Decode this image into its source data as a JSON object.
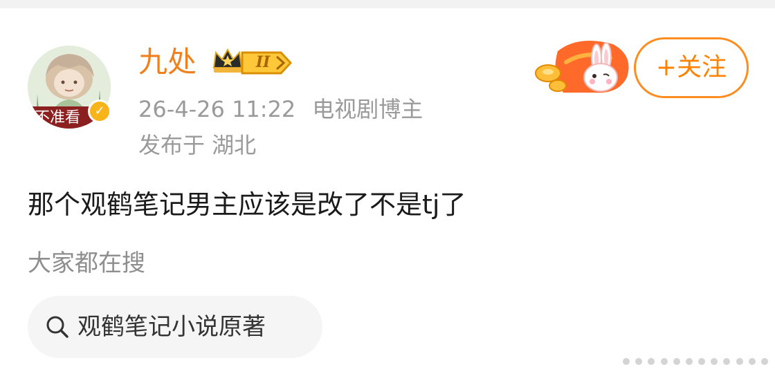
{
  "post": {
    "author": {
      "name": "九处",
      "avatar_caption": "不准看",
      "level_badge": "II",
      "verified_icon": "v-verified-icon"
    },
    "timestamp": "26-4-26 11:22",
    "role": "电视剧博主",
    "location": "发布于 湖北",
    "follow_label": "+关注",
    "text": "那个观鹤笔记男主应该是改了不是tj了"
  },
  "search_section": {
    "title": "大家都在搜",
    "chips": [
      {
        "icon": "search-icon",
        "label": "观鹤笔记小说原著"
      }
    ]
  },
  "colors": {
    "accent": "#ff8200",
    "username": "#f07f1e",
    "muted_text": "#9a9a9a",
    "body_text": "#1a1a1a",
    "chip_background": "#f5f5f5"
  }
}
